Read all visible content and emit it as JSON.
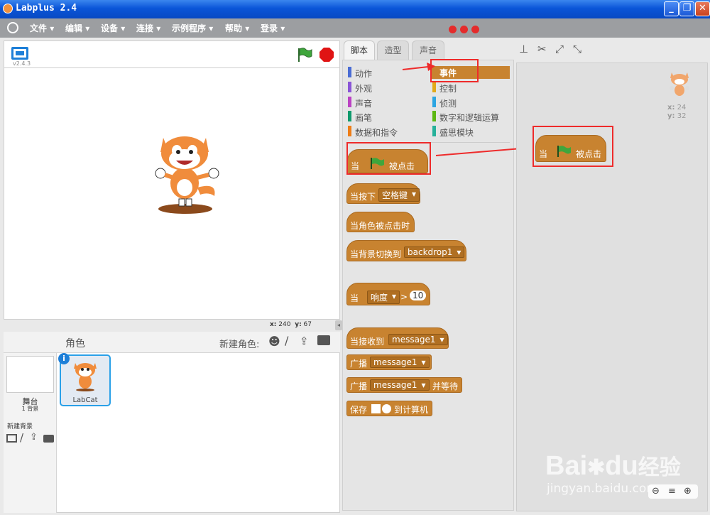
{
  "app": {
    "title": "Labplus 2.4",
    "version": "v2.4.3"
  },
  "menu": [
    "文件",
    "编辑",
    "设备",
    "连接",
    "示例程序",
    "帮助",
    "登录"
  ],
  "stage": {
    "mouse_x_label": "x:",
    "mouse_x": "240",
    "mouse_y_label": "y:",
    "mouse_y": "67"
  },
  "sprites": {
    "header": "角色",
    "new_sprite_label": "新建角色:",
    "items": [
      {
        "name": "LabCat"
      }
    ]
  },
  "stage_info": {
    "name": "舞台",
    "backdrops": "1 背景",
    "new_backdrop": "新建背景"
  },
  "tabs": [
    "脚本",
    "造型",
    "声音"
  ],
  "categories": {
    "left": [
      {
        "label": "动作",
        "color": "#4a6cd4"
      },
      {
        "label": "外观",
        "color": "#8a55d7"
      },
      {
        "label": "声音",
        "color": "#bb42c3"
      },
      {
        "label": "画笔",
        "color": "#0e9a6c"
      },
      {
        "label": "数据和指令",
        "color": "#ee7d16"
      }
    ],
    "right": [
      {
        "label": "事件",
        "color": "#c88330"
      },
      {
        "label": "控制",
        "color": "#e1a91a"
      },
      {
        "label": "侦测",
        "color": "#2ca5e2"
      },
      {
        "label": "数字和逻辑运算",
        "color": "#5cb712"
      },
      {
        "label": "盛思模块",
        "color": "#27b19a"
      }
    ]
  },
  "blocks": {
    "when_flag_prefix": "当",
    "when_flag_suffix": "被点击",
    "when_key": "当按下",
    "key_value": "空格键",
    "when_sprite": "当角色被点击时",
    "when_backdrop": "当背景切换到",
    "backdrop_value": "backdrop1",
    "when_prefix": "当",
    "loudness": "响度",
    "gt": ">",
    "threshold": "10",
    "when_receive": "当接收到",
    "message_value": "message1",
    "broadcast": "广播",
    "broadcast_wait": "并等待",
    "save": "保存",
    "save_suffix": "到计算机"
  },
  "script": {
    "sprite_x_label": "x:",
    "sprite_x": "24",
    "sprite_y_label": "y:",
    "sprite_y": "32"
  },
  "watermark": {
    "brand": "Bai",
    "du": "du",
    "jingyan": "经验",
    "url": "jingyan.baidu.com"
  },
  "colors": {
    "event": "#c88330",
    "highlight": "#ee2b2b"
  }
}
